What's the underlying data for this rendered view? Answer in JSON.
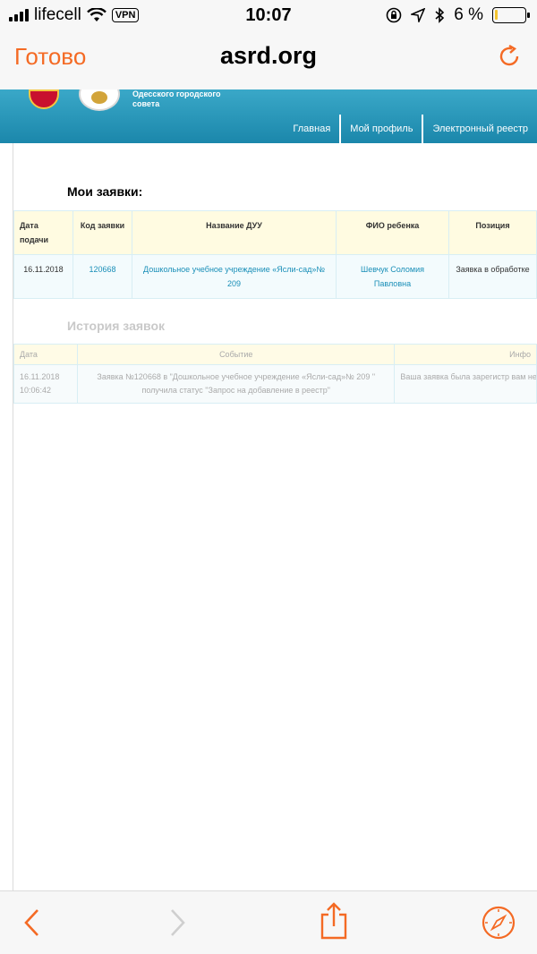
{
  "status_bar": {
    "carrier": "lifecell",
    "vpn": "VPN",
    "time": "10:07",
    "battery": "6 %"
  },
  "nav": {
    "done_label": "Готово",
    "title": "asrd.org"
  },
  "site": {
    "name_line1": "Одесского городского",
    "name_line2": "совета",
    "menu": [
      "Главная",
      "Мой профиль",
      "Электронный реестр"
    ]
  },
  "my_apps": {
    "title": "Мои заявки:",
    "headers": [
      "Дата подачи",
      "Код заявки",
      "Название ДУУ",
      "ФИО ребенка",
      "Позиция"
    ],
    "rows": [
      {
        "date": "16.11.2018",
        "code": "120668",
        "name": "Дошкольное учебное учреждение «Ясли-сад»№ 209",
        "child": "Шевчук Соломия Павловна",
        "position": "Заявка в обработке"
      }
    ]
  },
  "history": {
    "title": "История заявок",
    "headers": [
      "Дата",
      "Событие",
      "Инфо"
    ],
    "rows": [
      {
        "date": "16.11.2018 10:06:42",
        "event": "Заявка №120668 в \"Дошкольное учебное учреждение «Ясли-сад»№ 209 \" получила статус \"Запрос на добавление в реестр\"",
        "info": "Ваша заявка была зарегистр вам необходимо подтвердить"
      }
    ]
  },
  "colors": {
    "accent": "#f46a24",
    "header_blue": "#1b87ab",
    "link": "#1a8fb8"
  },
  "icons": {
    "back": "chevron-left-icon",
    "forward": "chevron-right-icon",
    "share": "share-icon",
    "compass": "compass-icon",
    "reload": "reload-icon"
  }
}
